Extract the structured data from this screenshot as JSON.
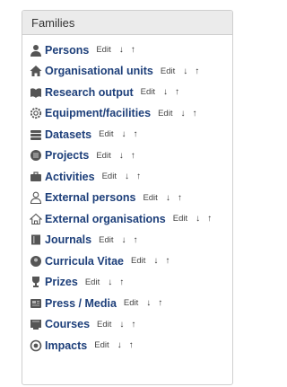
{
  "panel": {
    "title": "Families",
    "items": [
      {
        "label": "Persons",
        "icon": "person-icon",
        "edit": "Edit",
        "down": "↓",
        "up": "↑"
      },
      {
        "label": "Organisational units",
        "icon": "organisation-icon",
        "edit": "Edit",
        "down": "↓",
        "up": "↑"
      },
      {
        "label": "Research output",
        "icon": "book-icon",
        "edit": "Edit",
        "down": "↓",
        "up": "↑"
      },
      {
        "label": "Equipment/facilities",
        "icon": "gear-icon",
        "edit": "Edit",
        "down": "↓",
        "up": "↑"
      },
      {
        "label": "Datasets",
        "icon": "database-icon",
        "edit": "Edit",
        "down": "↓",
        "up": "↑"
      },
      {
        "label": "Projects",
        "icon": "project-icon",
        "edit": "Edit",
        "down": "↓",
        "up": "↑"
      },
      {
        "label": "Activities",
        "icon": "briefcase-icon",
        "edit": "Edit",
        "down": "↓",
        "up": "↑"
      },
      {
        "label": "External persons",
        "icon": "external-person-icon",
        "edit": "Edit",
        "down": "↓",
        "up": "↑"
      },
      {
        "label": "External organisations",
        "icon": "external-organisation-icon",
        "edit": "Edit",
        "down": "↓",
        "up": "↑"
      },
      {
        "label": "Journals",
        "icon": "journal-icon",
        "edit": "Edit",
        "down": "↓",
        "up": "↑"
      },
      {
        "label": "Curricula Vitae",
        "icon": "cv-icon",
        "edit": "Edit",
        "down": "↓",
        "up": "↑"
      },
      {
        "label": "Prizes",
        "icon": "trophy-icon",
        "edit": "Edit",
        "down": "↓",
        "up": "↑"
      },
      {
        "label": "Press / Media",
        "icon": "media-icon",
        "edit": "Edit",
        "down": "↓",
        "up": "↑"
      },
      {
        "label": "Courses",
        "icon": "course-icon",
        "edit": "Edit",
        "down": "↓",
        "up": "↑"
      },
      {
        "label": "Impacts",
        "icon": "impact-icon",
        "edit": "Edit",
        "down": "↓",
        "up": "↑"
      }
    ]
  },
  "colors": {
    "label": "#1d3f7a",
    "icon": "#555555",
    "header_bg": "#ebebeb",
    "border": "#cfcfcf"
  }
}
